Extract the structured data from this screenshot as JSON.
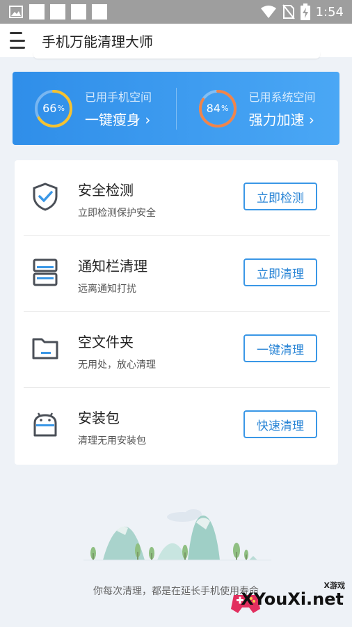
{
  "status_bar": {
    "time": "1:54",
    "icons": [
      "image-icon",
      "wifi-icon",
      "no-sim-icon",
      "battery-charging-icon"
    ]
  },
  "app_bar": {
    "title": "手机万能清理大师",
    "menu_icon": "menu-icon"
  },
  "storage": {
    "phone": {
      "percent": 66,
      "percent_label": "66",
      "unit": "%",
      "label": "已用手机空间",
      "action": "一键瘦身",
      "chevron": "›",
      "ring_color": "#f5c230"
    },
    "system": {
      "percent": 84,
      "percent_label": "84",
      "unit": "%",
      "label": "已用系统空间",
      "action": "强力加速",
      "chevron": "›",
      "ring_color": "#f0844a"
    }
  },
  "tools": [
    {
      "title": "安全检测",
      "desc": "立即检测保护安全",
      "button": "立即检测",
      "icon": "shield-check-icon"
    },
    {
      "title": "通知栏清理",
      "desc": "远离通知打扰",
      "button": "立即清理",
      "icon": "notification-bar-icon"
    },
    {
      "title": "空文件夹",
      "desc": "无用处，放心清理",
      "button": "一键清理",
      "icon": "folder-icon"
    },
    {
      "title": "安装包",
      "desc": "清理无用安装包",
      "button": "快速清理",
      "icon": "android-package-icon"
    }
  ],
  "footer": {
    "tagline": "你每次清理，都是在延长手机使用寿命"
  },
  "watermark": {
    "small": "X游戏",
    "main": "XYouXi.net"
  }
}
